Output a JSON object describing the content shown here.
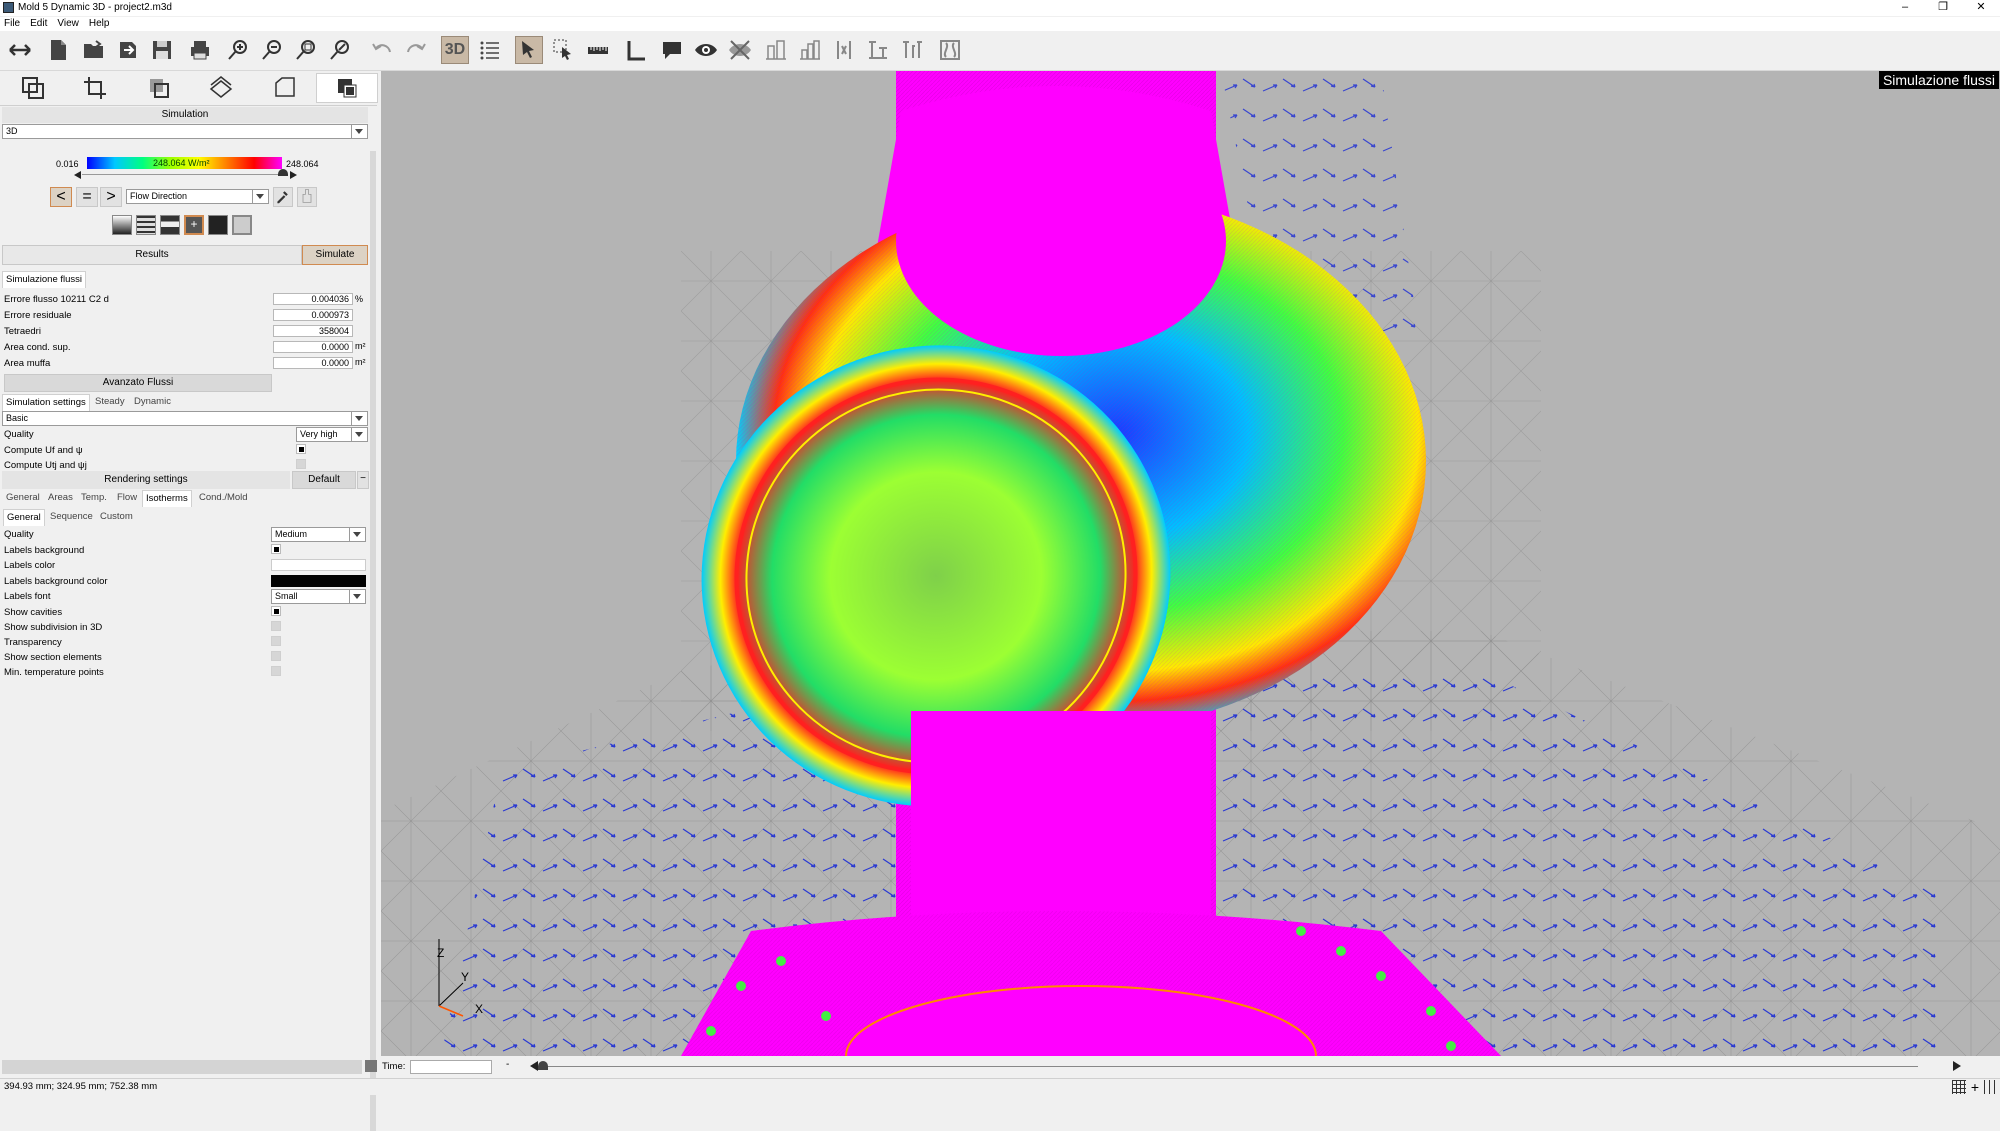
{
  "window": {
    "title": "Mold 5 Dynamic 3D - project2.m3d"
  },
  "menu": [
    "File",
    "Edit",
    "View",
    "Help"
  ],
  "toolbar": {
    "mode3d": "3D"
  },
  "simulation": {
    "header": "Simulation",
    "view_select": "3D",
    "scale_min": "0.016",
    "scale_mid": "248.064 W/m²",
    "scale_max": "248.064",
    "direction_select": "Flow Direction",
    "results_btn": "Results",
    "simulate_btn": "Simulate"
  },
  "flow": {
    "section": "Simulazione flussi",
    "rows": [
      {
        "label": "Errore flusso 10211 C2 d",
        "value": "0.004036",
        "unit": "%"
      },
      {
        "label": "Errore residuale",
        "value": "0.000973",
        "unit": ""
      },
      {
        "label": "Tetraedri",
        "value": "358004",
        "unit": ""
      },
      {
        "label": "Area cond. sup.",
        "value": "0.0000",
        "unit": "m²"
      },
      {
        "label": "Area muffa",
        "value": "0.0000",
        "unit": "m²"
      }
    ],
    "advanced_btn": "Avanzato Flussi"
  },
  "sim_settings": {
    "tabs": [
      "Simulation settings",
      "Steady",
      "Dynamic"
    ],
    "preset": "Basic",
    "quality_label": "Quality",
    "quality_value": "Very high",
    "compute1": "Compute Uf and ψ",
    "compute2": "Compute Utj and ψj"
  },
  "rendering": {
    "header": "Rendering settings",
    "default_btn": "Default",
    "tabs": [
      "General",
      "Areas",
      "Temp.",
      "Flow",
      "Isotherms",
      "Cond./Mold"
    ],
    "subtabs": [
      "General",
      "Sequence",
      "Custom"
    ],
    "quality_label": "Quality",
    "quality_value": "Medium",
    "labels_bg": "Labels background",
    "labels_color": "Labels color",
    "labels_bg_color": "Labels background color",
    "labels_font": "Labels font",
    "labels_font_value": "Small",
    "show_cavities": "Show cavities",
    "show_subdivision": "Show subdivision in 3D",
    "transparency": "Transparency",
    "show_section": "Show section elements",
    "min_temp": "Min. temperature points"
  },
  "viewport": {
    "overlay_title": "Simulazione flussi",
    "axis_z": "Z",
    "axis_y": "Y",
    "axis_x": "X"
  },
  "timeline": {
    "label": "Time:",
    "sep": "-"
  },
  "status": {
    "coords": "394.93 mm; 324.95 mm; 752.38 mm"
  },
  "colors": {
    "magenta": "#ff00ff",
    "viewport_bg": "#b4b4b4",
    "accent": "#d08a50"
  }
}
